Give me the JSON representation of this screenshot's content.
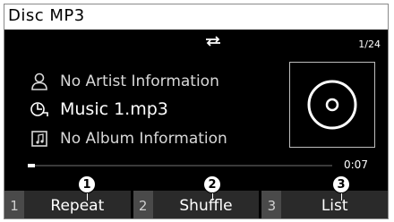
{
  "title": "Disc MP3",
  "track_counter": "1/24",
  "icons": {
    "repeat": "repeat-icon",
    "artist": "person-icon",
    "song": "music-note-icon",
    "album": "album-icon",
    "disc": "disc-icon"
  },
  "artist": "No Artist Information",
  "song": "Music 1.mp3",
  "album": "No Album Information",
  "playback": {
    "elapsed": "0:07",
    "progress_fraction": 0.02
  },
  "softkeys": [
    {
      "number": "1",
      "label": "Repeat",
      "callout": "1"
    },
    {
      "number": "2",
      "label": "Shuffle",
      "callout": "2"
    },
    {
      "number": "3",
      "label": "List",
      "callout": "3"
    }
  ]
}
